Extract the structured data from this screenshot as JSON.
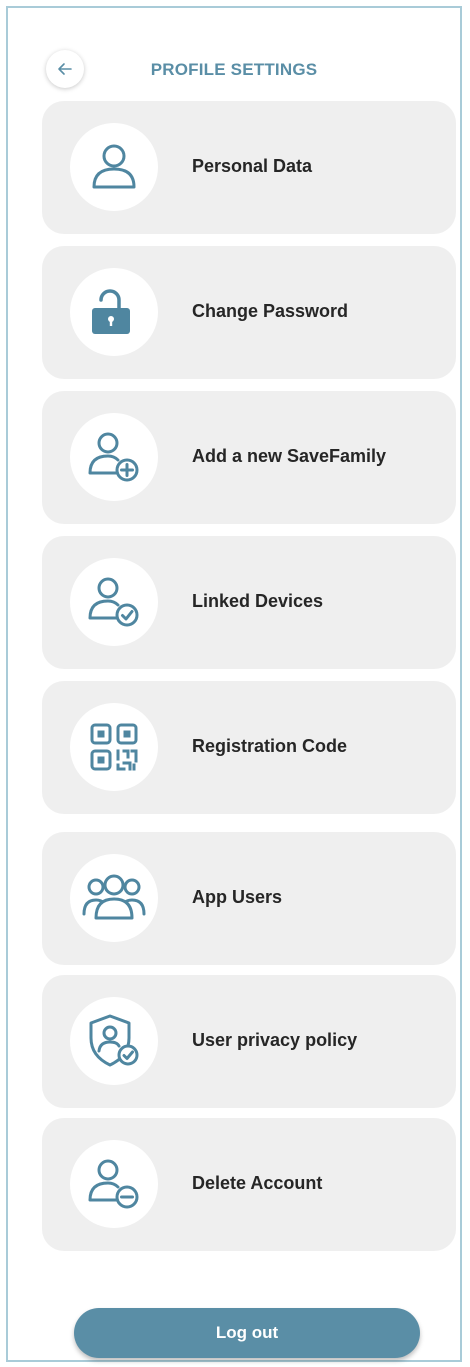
{
  "header": {
    "title": "PROFILE SETTINGS",
    "back_icon": "back-arrow-icon"
  },
  "menu": {
    "items": [
      {
        "label": "Personal Data",
        "icon": "user-icon"
      },
      {
        "label": "Change Password",
        "icon": "unlocked-padlock-icon"
      },
      {
        "label": "Add a new SaveFamily",
        "icon": "user-add-icon"
      },
      {
        "label": "Linked Devices",
        "icon": "user-check-icon"
      },
      {
        "label": "Registration Code",
        "icon": "qr-code-icon"
      },
      {
        "label": "App Users",
        "icon": "users-group-icon"
      },
      {
        "label": "User privacy policy",
        "icon": "shield-user-check-icon"
      },
      {
        "label": "Delete Account",
        "icon": "user-remove-icon"
      }
    ]
  },
  "footer": {
    "logout_label": "Log out"
  },
  "colors": {
    "accent": "#5a8ea6",
    "card_background": "#efefef",
    "text": "#262626",
    "frame_border": "#a9cbd8"
  }
}
